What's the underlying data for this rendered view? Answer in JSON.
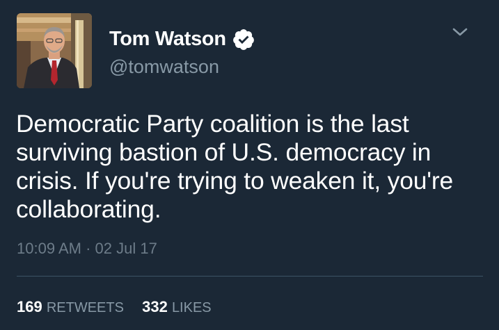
{
  "author": {
    "name": "Tom Watson",
    "handle": "@tomwatson",
    "verified": true
  },
  "tweet": {
    "text_lines": [
      "Democratic Party coalition is the last",
      "surviving bastion of U.S. democracy in",
      "crisis. If you're trying to weaken it, you're",
      "collaborating."
    ],
    "time": "10:09 AM",
    "separator": "·",
    "date": "02 Jul 17"
  },
  "stats": {
    "retweets_count": "169",
    "retweets_label": "RETWEETS",
    "likes_count": "332",
    "likes_label": "LIKES"
  },
  "colors": {
    "background": "#1b2836",
    "text_primary": "#ffffff",
    "text_secondary": "#8899a6",
    "divider": "#3d5466"
  },
  "icons": {
    "verified": "verified-badge-icon",
    "menu": "chevron-down-icon"
  }
}
